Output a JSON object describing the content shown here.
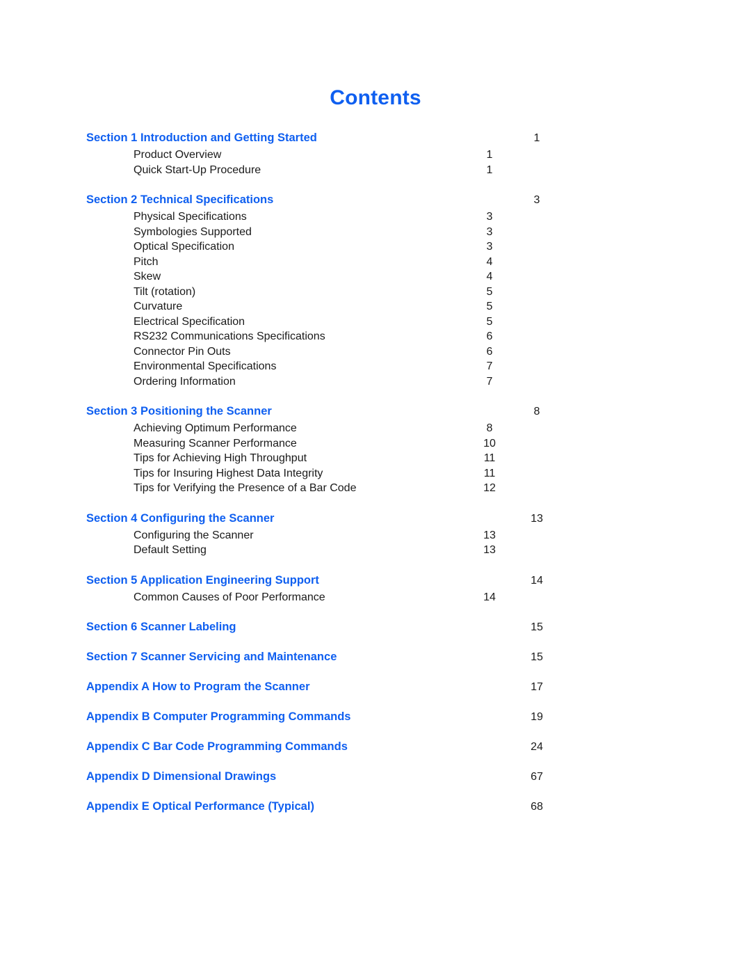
{
  "document": {
    "title": "Contents",
    "accent_color": "#0f5ff0",
    "text_color": "#1a1a1a",
    "background_color": "#ffffff"
  },
  "toc": {
    "groups": [
      {
        "heading": "Section 1  Introduction and Getting Started",
        "page": "1",
        "items": [
          {
            "label": "Product Overview",
            "page": "1"
          },
          {
            "label": "Quick Start-Up Procedure",
            "page": "1"
          }
        ]
      },
      {
        "heading": "Section 2  Technical Specifications",
        "page": "3",
        "items": [
          {
            "label": "Physical Specifications",
            "page": "3"
          },
          {
            "label": "Symbologies Supported",
            "page": "3"
          },
          {
            "label": "Optical Specification",
            "page": "3"
          },
          {
            "label": "Pitch",
            "page": "4"
          },
          {
            "label": "Skew",
            "page": "4"
          },
          {
            "label": "Tilt (rotation)",
            "page": "5"
          },
          {
            "label": "Curvature",
            "page": "5"
          },
          {
            "label": "Electrical Specification",
            "page": "5"
          },
          {
            "label": "RS232 Communications Specifications",
            "page": "6"
          },
          {
            "label": "Connector Pin Outs",
            "page": "6"
          },
          {
            "label": "Environmental Specifications",
            "page": "7"
          },
          {
            "label": "Ordering Information",
            "page": "7"
          }
        ]
      },
      {
        "heading": "Section 3  Positioning the Scanner",
        "page": "8",
        "items": [
          {
            "label": "Achieving Optimum Performance",
            "page": "8"
          },
          {
            "label": "Measuring Scanner Performance",
            "page": "10"
          },
          {
            "label": "Tips for Achieving High Throughput",
            "page": "11"
          },
          {
            "label": "Tips for Insuring Highest Data Integrity",
            "page": "11"
          },
          {
            "label": "Tips for Verifying the Presence of a Bar Code",
            "page": "12"
          }
        ]
      },
      {
        "heading": "Section 4  Configuring the Scanner",
        "page": "13",
        "items": [
          {
            "label": "Configuring the Scanner",
            "page": "13"
          },
          {
            "label": "Default Setting",
            "page": "13"
          }
        ]
      },
      {
        "heading": "Section 5  Application Engineering Support",
        "page": "14",
        "items": [
          {
            "label": "Common Causes of Poor Performance",
            "page": "14"
          }
        ]
      },
      {
        "heading": "Section 6  Scanner Labeling",
        "page": "15",
        "items": []
      },
      {
        "heading": "Section 7 Scanner Servicing and Maintenance",
        "page": "15",
        "items": []
      },
      {
        "heading": "Appendix A  How to Program the Scanner",
        "page": "17",
        "items": []
      },
      {
        "heading": "Appendix B  Computer Programming Commands",
        "page": "19",
        "items": []
      },
      {
        "heading": "Appendix C  Bar Code Programming Commands",
        "page": "24",
        "items": []
      },
      {
        "heading": "Appendix D  Dimensional Drawings",
        "page": "67",
        "items": []
      },
      {
        "heading": "Appendix E  Optical Performance (Typical)",
        "page": "68",
        "items": []
      }
    ]
  }
}
